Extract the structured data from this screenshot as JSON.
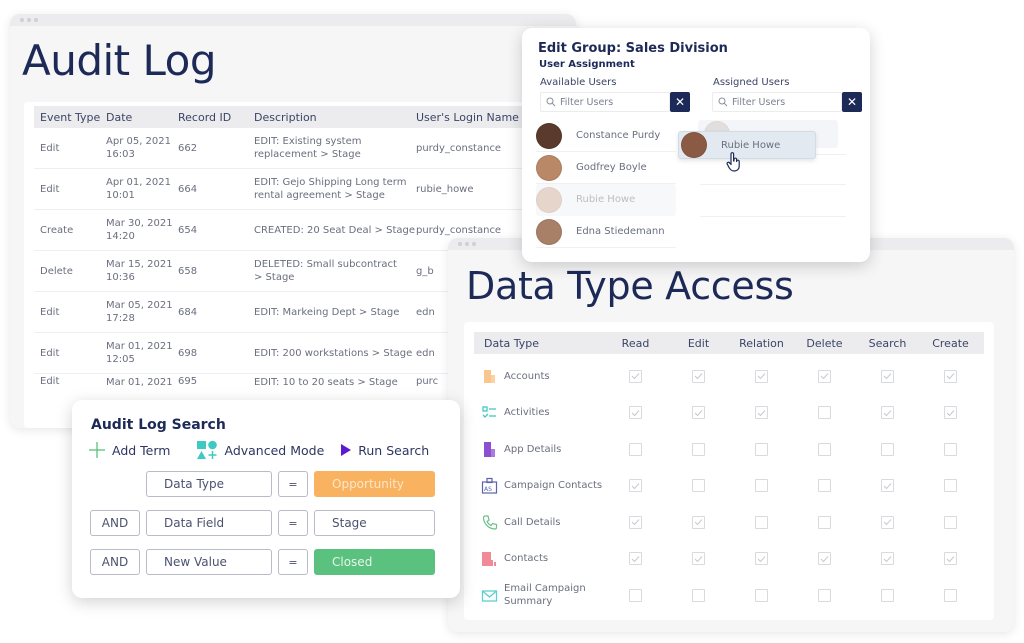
{
  "audit_log": {
    "title": "Audit Log",
    "columns": [
      "Event Type",
      "Date",
      "Record ID",
      "Description",
      "User's Login Name"
    ],
    "rows": [
      {
        "event": "Edit",
        "date": "Apr 05, 2021",
        "time": "16:03",
        "id": "662",
        "desc1": "EDIT: Existing system",
        "desc2": "replacement > Stage",
        "user": "purdy_constance"
      },
      {
        "event": "Edit",
        "date": "Apr 01, 2021",
        "time": "10:01",
        "id": "664",
        "desc1": "EDIT: Gejo Shipping Long term",
        "desc2": "rental agreement > Stage",
        "user": "rubie_howe"
      },
      {
        "event": "Create",
        "date": "Mar 30, 2021",
        "time": "14:20",
        "id": "654",
        "desc1": "CREATED:  20 Seat Deal > Stage",
        "desc2": "",
        "user": "purdy_constance"
      },
      {
        "event": "Delete",
        "date": "Mar 15, 2021",
        "time": "10:36",
        "id": "658",
        "desc1": "DELETED: Small subcontract",
        "desc2": "> Stage",
        "user": "g_b"
      },
      {
        "event": "Edit",
        "date": "Mar 05, 2021",
        "time": "17:28",
        "id": "684",
        "desc1": "EDIT: Markeing Dept > Stage",
        "desc2": "",
        "user": "edn"
      },
      {
        "event": "Edit",
        "date": "Mar 01, 2021",
        "time": "12:05",
        "id": "698",
        "desc1": "EDIT: 200 workstations > Stage",
        "desc2": "",
        "user": "edn"
      },
      {
        "event": "Edit",
        "date": "Mar 01, 2021",
        "time": "",
        "id": "695",
        "desc1": "EDIT: 10 to 20 seats > Stage",
        "desc2": "",
        "user": "purc"
      }
    ]
  },
  "edit_group": {
    "title": "Edit Group: Sales Division",
    "subtitle": "User Assignment",
    "available_label": "Available Users",
    "assigned_label": "Assigned Users",
    "filter_placeholder": "Filter Users",
    "available_users": [
      {
        "name": "Constance Purdy",
        "avatar_color": "#5a3a2c"
      },
      {
        "name": "Godfrey Boyle",
        "avatar_color": "#b98866"
      },
      {
        "name": "Rubie Howe",
        "avatar_color": "#c9a48c",
        "state": "dragging-placeholder"
      },
      {
        "name": "Edna Stiedemann",
        "avatar_color": "#a87f67"
      }
    ],
    "dragged_user": {
      "name": "Rubie Howe",
      "avatar_color": "#8a5a44"
    }
  },
  "data_type_access": {
    "title": "Data Type Access",
    "columns": [
      "Data Type",
      "Read",
      "Edit",
      "Relation",
      "Delete",
      "Search",
      "Create"
    ],
    "rows": [
      {
        "name": "Accounts",
        "icon": "building-icon",
        "color": "#f9c78d",
        "perms": [
          true,
          true,
          true,
          true,
          true,
          true
        ]
      },
      {
        "name": "Activities",
        "icon": "checklist-icon",
        "color": "#3fc9c3",
        "perms": [
          true,
          true,
          true,
          false,
          true,
          true
        ]
      },
      {
        "name": "App Details",
        "icon": "app-building-icon",
        "color": "#8b4fd0",
        "perms": [
          false,
          false,
          false,
          false,
          false,
          false
        ]
      },
      {
        "name": "Campaign Contacts",
        "icon": "id-badge-icon",
        "color": "#5a64a8",
        "perms": [
          true,
          false,
          false,
          false,
          true,
          false
        ]
      },
      {
        "name": "Call Details",
        "icon": "phone-icon",
        "color": "#6cc08a",
        "perms": [
          true,
          true,
          false,
          false,
          true,
          false
        ]
      },
      {
        "name": "Contacts",
        "icon": "contacts-building-icon",
        "color": "#f08a96",
        "perms": [
          true,
          true,
          true,
          true,
          true,
          true
        ]
      },
      {
        "name": "Email Campaign Summary",
        "icon": "envelope-icon",
        "color": "#5fcfd0",
        "perms": [
          false,
          false,
          false,
          false,
          false,
          false
        ]
      }
    ]
  },
  "audit_search": {
    "title": "Audit Log Search",
    "toolbar": {
      "add_term": "Add Term",
      "advanced_mode": "Advanced Mode",
      "run_search": "Run Search"
    },
    "terms": [
      {
        "connector": "",
        "field": "Data Type",
        "operator": "=",
        "value": "Opportunity",
        "value_style": "orange"
      },
      {
        "connector": "AND",
        "field": "Data Field",
        "operator": "=",
        "value": "Stage",
        "value_style": "plain"
      },
      {
        "connector": "AND",
        "field": "New Value",
        "operator": "=",
        "value": "Closed",
        "value_style": "green"
      }
    ]
  }
}
